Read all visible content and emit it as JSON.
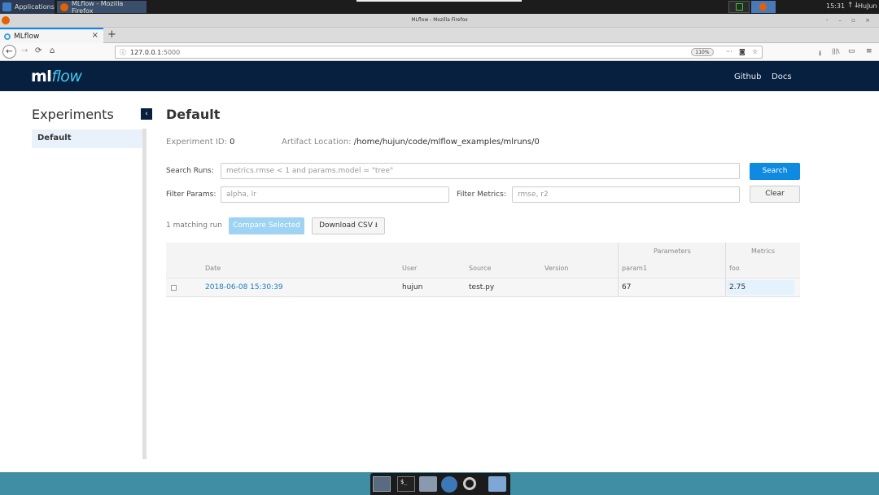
{
  "system": {
    "apps_label": "Applications",
    "task_label": "MLflow - Mozilla Firefox",
    "time": "15:31",
    "net_icon": "↑↓",
    "user": "HuJun"
  },
  "browser": {
    "window_title": "MLflow - Mozilla Firefox",
    "tab_title": "MLflow",
    "tab_close": "×",
    "new_tab": "+",
    "url_host": "127.0.0.1",
    "url_port": ":5000",
    "zoom": "110%",
    "icons": {
      "back": "←",
      "forward": "→",
      "reload": "⟳",
      "home": "⌂",
      "info": "ⓘ",
      "more": "···",
      "pocket": "◙",
      "star": "☆",
      "download": "⭳",
      "library": "|||\\",
      "sidebar": "▭",
      "menu": "≡",
      "win_controls": "◦ – ▫ ×"
    }
  },
  "mlflow": {
    "logo_ml": "ml",
    "logo_flow": "flow",
    "nav": [
      "Github",
      "Docs"
    ]
  },
  "sidebar": {
    "title": "Experiments",
    "collapse_icon": "‹",
    "items": [
      "Default"
    ]
  },
  "experiment": {
    "title": "Default",
    "id_label": "Experiment ID:",
    "id_value": "0",
    "artifact_label": "Artifact Location:",
    "artifact_value": "/home/hujun/code/mlflow_examples/mlruns/0"
  },
  "filters": {
    "search_label": "Search Runs:",
    "search_placeholder": "metrics.rmse < 1 and params.model = \"tree\"",
    "params_label": "Filter Params:",
    "params_placeholder": "alpha, lr",
    "metrics_label": "Filter Metrics:",
    "metrics_placeholder": "rmse, r2",
    "search_button": "Search",
    "clear_button": "Clear"
  },
  "runs": {
    "matching": "1 matching run",
    "compare_button": "Compare Selected",
    "download_button": "Download CSV ⭳",
    "group_headers": [
      "Parameters",
      "Metrics"
    ],
    "columns": [
      "Date",
      "User",
      "Source",
      "Version",
      "param1",
      "foo"
    ],
    "rows": [
      {
        "date": "2018-06-08 15:30:39",
        "user": "hujun",
        "source": "test.py",
        "version": "",
        "param1": "67",
        "foo": "2.75"
      }
    ]
  },
  "colors": {
    "header_bg": "#082040",
    "accent": "#0e8ae0",
    "link": "#1a7cc1",
    "taskbar": "#3f8ea4"
  }
}
